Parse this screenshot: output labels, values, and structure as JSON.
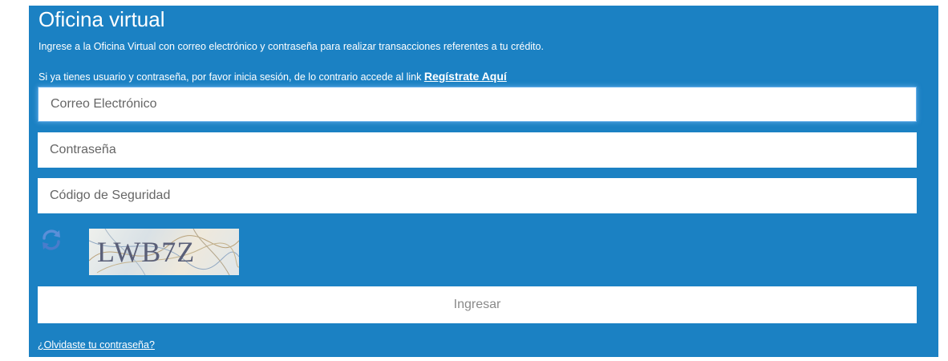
{
  "panel": {
    "title": "Oficina virtual",
    "intro": "Ingrese a la Oficina Virtual con correo electrónico y contraseña para realizar transacciones referentes a tu crédito.",
    "session_note": "Si ya tienes usuario y contraseña, por favor inicia sesión, de lo contrario accede al link",
    "register_link": "Regístrate Aquí",
    "background_color": "#1b81c3"
  },
  "form": {
    "email_placeholder": "Correo Electrónico",
    "email_value": "",
    "password_placeholder": "Contraseña",
    "password_value": "",
    "code_placeholder": "Código de Seguridad",
    "code_value": ""
  },
  "captcha": {
    "refresh_icon": "refresh-icon",
    "text": "LWB7Z"
  },
  "submit_label": "Ingresar",
  "forgot_password_link": "¿Olvidaste tu contraseña?"
}
